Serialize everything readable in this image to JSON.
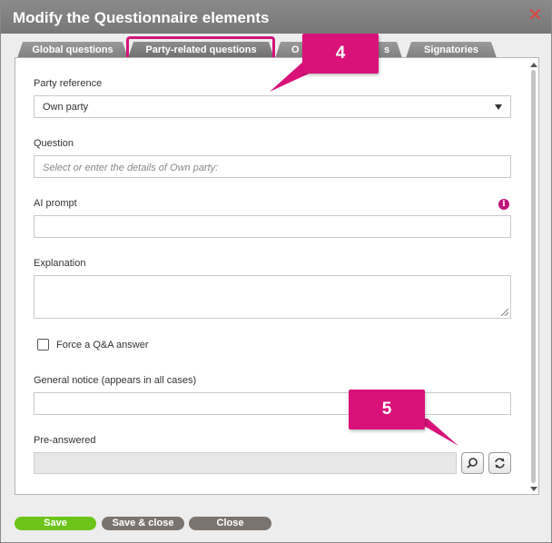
{
  "dialog": {
    "title": "Modify the Questionnaire elements",
    "close_icon": "close-icon"
  },
  "tabs": [
    {
      "label": "Global questions",
      "active": false
    },
    {
      "label": "Party-related questions",
      "active": true
    },
    {
      "label": "O",
      "active": false
    },
    {
      "label": "s",
      "active": false
    },
    {
      "label": "Signatories",
      "active": false
    }
  ],
  "form": {
    "party_reference": {
      "label": "Party reference",
      "value": "Own party"
    },
    "question": {
      "label": "Question",
      "placeholder": "Select or enter the details of Own party:"
    },
    "ai_prompt": {
      "label": "AI prompt",
      "value": "",
      "info_icon": "info-icon"
    },
    "explanation": {
      "label": "Explanation",
      "value": ""
    },
    "force_qa": {
      "label": "Force a Q&A answer",
      "checked": false
    },
    "general_notice": {
      "label": "General notice (appears in all cases)",
      "value": ""
    },
    "pre_answered": {
      "label": "Pre-answered",
      "value": "",
      "search_icon": "search-icon",
      "refresh_icon": "refresh-icon"
    }
  },
  "callouts": [
    {
      "label": "4"
    },
    {
      "label": "5"
    }
  ],
  "footer": {
    "save_label": "Save",
    "save_close_label": "Save & close",
    "close_label": "Close"
  },
  "colors": {
    "accent": "#d9127a",
    "save_green": "#6cc418",
    "button_gray": "#7a7470",
    "titlebar": "#808080"
  }
}
